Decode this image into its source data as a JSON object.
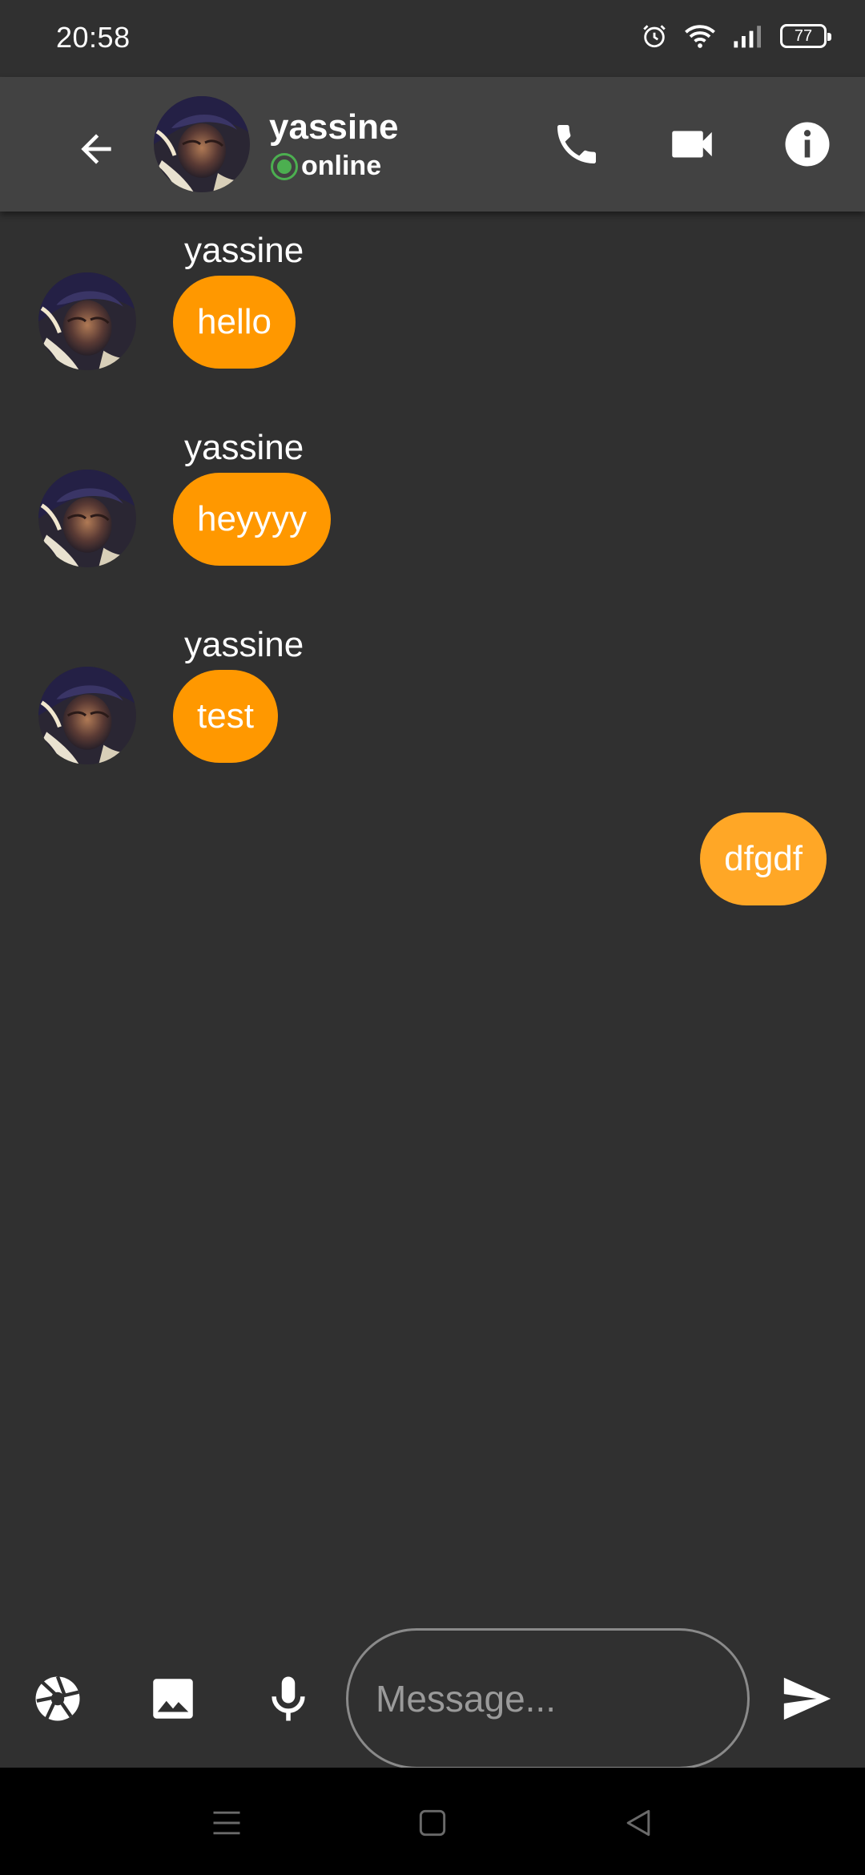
{
  "status_bar": {
    "time": "20:58",
    "battery_level": "77",
    "icons": [
      "alarm-icon",
      "wifi-icon",
      "signal-icon",
      "battery-icon"
    ]
  },
  "header": {
    "contact_name": "yassine",
    "presence": "online",
    "icons": [
      "back-arrow-icon",
      "phone-icon",
      "video-camera-icon",
      "info-icon"
    ]
  },
  "messages": [
    {
      "direction": "incoming",
      "sender": "yassine",
      "text": "hello"
    },
    {
      "direction": "incoming",
      "sender": "yassine",
      "text": "heyyyy"
    },
    {
      "direction": "incoming",
      "sender": "yassine",
      "text": "test"
    },
    {
      "direction": "outgoing",
      "text": "dfgdf"
    }
  ],
  "composer": {
    "placeholder": "Message...",
    "value": "",
    "icons": [
      "camera-shutter-icon",
      "image-icon",
      "microphone-icon",
      "send-icon"
    ]
  },
  "nav_bar": {
    "icons": [
      "menu-icon",
      "home-icon",
      "back-triangle-icon"
    ]
  },
  "colors": {
    "background": "#303030",
    "app_bar": "#424242",
    "incoming_bubble": "#ff9800",
    "outgoing_bubble": "#ffa726",
    "online_indicator": "#4caf50"
  }
}
